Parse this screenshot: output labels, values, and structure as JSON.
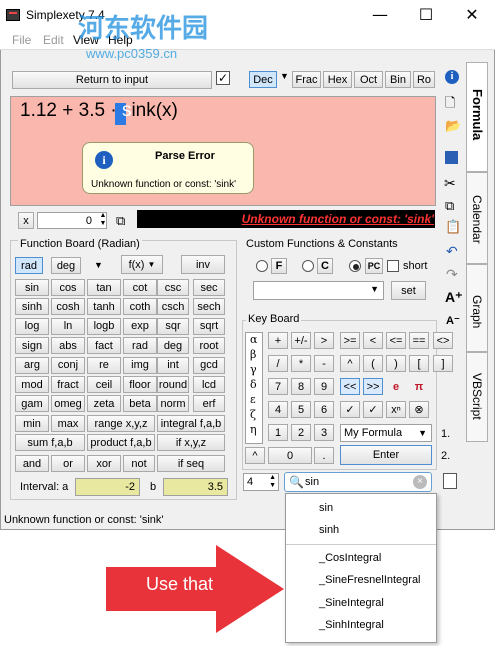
{
  "window": {
    "title": "Simplexety 7.4",
    "min": "—",
    "max": "☐",
    "close": "✕"
  },
  "watermark": {
    "line1": "河东软件园",
    "line2": "www.pc0359.cn"
  },
  "menu": [
    "File",
    "Edit",
    "View",
    "Help"
  ],
  "toolbar": {
    "return_label": "Return to input",
    "formats": [
      "Dec",
      "Frac",
      "Hex",
      "Oct",
      "Bin",
      "Ro"
    ],
    "selected_format": "Dec"
  },
  "expression": {
    "before": "1.12 + 3.5 · ",
    "selected": "s",
    "after": "ink(x)"
  },
  "error_popup": {
    "title": "Parse Error",
    "message": "Unknown function or const: 'sink'"
  },
  "result_row": {
    "var": "x",
    "value": "0",
    "error": "Unknown function or const: 'sink'"
  },
  "function_board": {
    "title": "Function Board (Radian)",
    "mode_buttons": [
      "rad",
      "deg"
    ],
    "fx_label": "f(x)",
    "inv_label": "inv",
    "rows": [
      [
        "sin",
        "cos",
        "tan",
        "cot",
        "csc",
        "sec"
      ],
      [
        "sinh",
        "cosh",
        "tanh",
        "coth",
        "csch",
        "sech"
      ],
      [
        "log",
        "ln",
        "logb",
        "exp",
        "sqr",
        "sqrt"
      ],
      [
        "sign",
        "abs",
        "fact",
        "rad",
        "deg",
        "root"
      ],
      [
        "arg",
        "conj",
        "re",
        "img",
        "int",
        "gcd"
      ],
      [
        "mod",
        "fract",
        "ceil",
        "floor",
        "round",
        "lcd"
      ],
      [
        "gam",
        "omeg",
        "zeta",
        "beta",
        "norm",
        "erf"
      ]
    ],
    "row_min": [
      "min",
      "max",
      "range x,y,z",
      "integral f,a,b"
    ],
    "row_sum": [
      "sum f,a,b",
      "product f,a,b",
      "if x,y,z"
    ],
    "row_logic": [
      "and",
      "or",
      "xor",
      "not",
      "if seq"
    ],
    "interval_label": "Interval: a",
    "interval_a": "-2",
    "interval_b_label": "b",
    "interval_b": "3.5"
  },
  "custom": {
    "title": "Custom Functions & Constants",
    "radio": [
      "F",
      "C",
      "PC"
    ],
    "short_label": "short",
    "set_label": "set"
  },
  "keyboard": {
    "title": "Key Board",
    "greek": [
      "α",
      "β",
      "γ",
      "δ",
      "ε",
      "ζ",
      "η"
    ],
    "rows": [
      [
        "+",
        "+/-",
        ">",
        ">=",
        "<",
        "<=",
        "==",
        "<>"
      ],
      [
        "/",
        "*",
        "-",
        "^",
        "(",
        ")",
        "[",
        "]"
      ],
      [
        "7",
        "8",
        "9",
        "<<",
        ">>",
        "e",
        "π"
      ],
      [
        "4",
        "5",
        "6",
        "✓",
        "✓",
        "xⁿ",
        "⊗"
      ],
      [
        "1",
        "2",
        "3"
      ]
    ],
    "formula_select": "My Formula",
    "enter_label": "Enter",
    "zero": "0",
    "dot": ".",
    "line1": "1.",
    "line2": "2.",
    "up_arrow": "^",
    "precision": "4",
    "search_value": "sin"
  },
  "side_tabs": [
    "Formula",
    "Calendar",
    "Graph",
    "VBScript"
  ],
  "status": "Unknown function or const: 'sink'",
  "suggestions": [
    "sin",
    "sinh",
    "_CosIntegral",
    "_SineFresnelIntegral",
    "_SineIntegral",
    "_SinhIntegral"
  ],
  "callout": "Use that"
}
